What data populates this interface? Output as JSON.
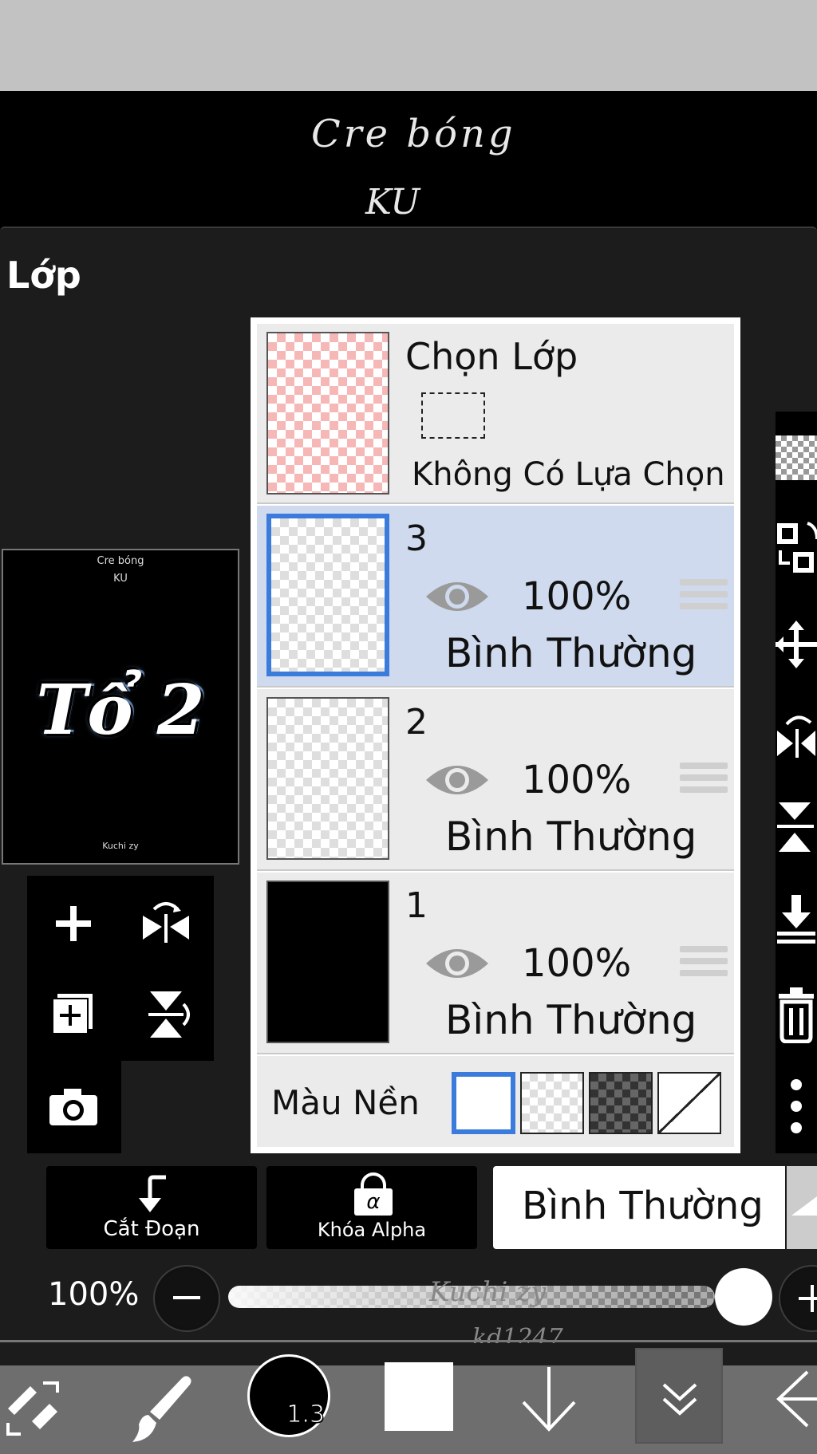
{
  "canvas": {
    "handwriting_line1": "Cre bóng",
    "handwriting_line2": "KU"
  },
  "panel": {
    "title": "Lớp"
  },
  "preview": {
    "top_text1": "Cre bóng",
    "top_text2": "KU",
    "art_text": "Tổ 2",
    "bottom_text": "Kuchi zy"
  },
  "selection_layer": {
    "title": "Chọn Lớp",
    "status": "Không Có Lựa Chọn"
  },
  "layers": [
    {
      "number": "3",
      "opacity": "100%",
      "mode": "Bình Thường",
      "selected": true,
      "visible": true
    },
    {
      "number": "2",
      "opacity": "100%",
      "mode": "Bình Thường",
      "selected": false,
      "visible": true
    },
    {
      "number": "1",
      "opacity": "100%",
      "mode": "Bình Thường",
      "selected": false,
      "visible": true
    }
  ],
  "background_color": {
    "label": "Màu Nền",
    "options": [
      "white",
      "transparent",
      "dark-checker",
      "none"
    ],
    "selected": "white"
  },
  "controls": {
    "clip_label": "Cắt Đoạn",
    "alpha_lock_label": "Khóa Alpha",
    "alpha_symbol": "α",
    "blend_mode": "Bình Thường",
    "opacity": "100%",
    "opacity_value": 1.0
  },
  "canvas_overlay": {
    "handwriting_line3": "Kuchi zy",
    "handwriting_line4": "kd1247"
  },
  "toolbar": {
    "brush_size": "1.3",
    "color": "#ffffff"
  },
  "colors": {
    "accent": "#3a7bdc",
    "selected_row": "#cfdaee",
    "panel_bg": "#1c1c1c"
  }
}
